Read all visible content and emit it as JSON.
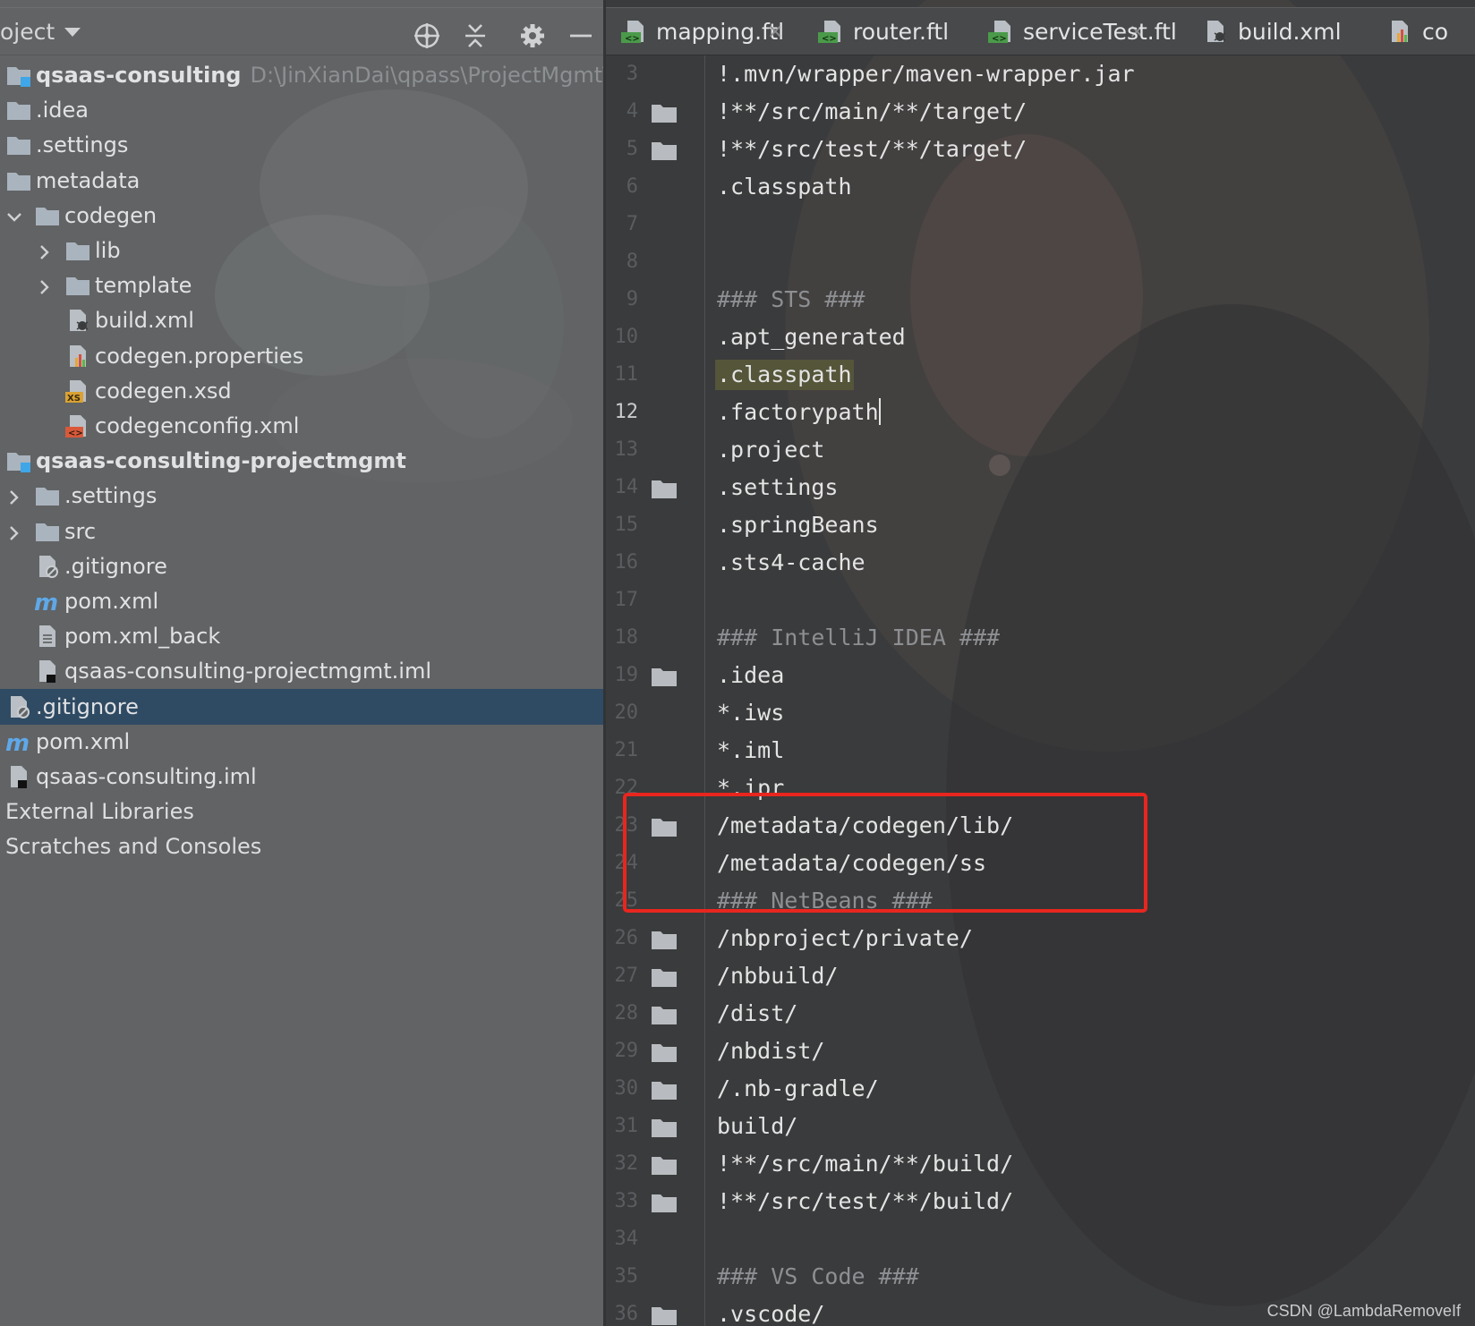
{
  "project_panel": {
    "title": "oject",
    "header_icons": [
      "locate-icon",
      "collapse-all-icon",
      "gear-icon",
      "minimize-icon"
    ],
    "tree": [
      {
        "label": "qsaas-consulting",
        "path": "D:\\JinXianDai\\qpass\\ProjectMgmt\\proje",
        "icon": "module-folder-icon",
        "bold": true,
        "chevron": "none"
      },
      {
        "label": ".idea",
        "icon": "folder-icon",
        "chevron": "none"
      },
      {
        "label": ".settings",
        "icon": "folder-icon",
        "chevron": "none"
      },
      {
        "label": "metadata",
        "icon": "folder-icon",
        "chevron": "none"
      },
      {
        "label": "codegen",
        "icon": "folder-icon",
        "chevron": "expanded"
      },
      {
        "label": "lib",
        "icon": "folder-icon",
        "chevron": "collapsed"
      },
      {
        "label": "template",
        "icon": "folder-icon",
        "chevron": "collapsed"
      },
      {
        "label": "build.xml",
        "icon": "ant-build-file-icon",
        "chevron": "none"
      },
      {
        "label": "codegen.properties",
        "icon": "properties-file-icon",
        "chevron": "none"
      },
      {
        "label": "codegen.xsd",
        "icon": "xsd-file-icon",
        "chevron": "none"
      },
      {
        "label": "codegenconfig.xml",
        "icon": "xml-file-icon",
        "chevron": "none"
      },
      {
        "label": "qsaas-consulting-projectmgmt",
        "icon": "module-folder-icon",
        "bold": true,
        "chevron": "none"
      },
      {
        "label": ".settings",
        "icon": "folder-icon",
        "chevron": "collapsed"
      },
      {
        "label": "src",
        "icon": "folder-icon",
        "chevron": "collapsed"
      },
      {
        "label": ".gitignore",
        "icon": "gitignore-file-icon",
        "chevron": "none"
      },
      {
        "label": "pom.xml",
        "icon": "maven-icon",
        "chevron": "none"
      },
      {
        "label": "pom.xml_back",
        "icon": "text-file-icon",
        "chevron": "none"
      },
      {
        "label": "qsaas-consulting-projectmgmt.iml",
        "icon": "iml-file-icon",
        "chevron": "none"
      },
      {
        "label": ".gitignore",
        "icon": "gitignore-file-icon",
        "chevron": "none",
        "selected": true
      },
      {
        "label": "pom.xml",
        "icon": "maven-icon",
        "chevron": "none"
      },
      {
        "label": "qsaas-consulting.iml",
        "icon": "iml-file-icon",
        "chevron": "none"
      },
      {
        "label": "External Libraries",
        "icon": "none",
        "chevron": "none"
      },
      {
        "label": "Scratches and Consoles",
        "icon": "none",
        "chevron": "none"
      }
    ]
  },
  "tabs": [
    {
      "label": "mapping.ftl",
      "icon": "ftl-file-icon",
      "close": "×"
    },
    {
      "label": "router.ftl",
      "icon": "ftl-file-icon",
      "close": "×"
    },
    {
      "label": "serviceTest.ftl",
      "icon": "ftl-file-icon",
      "close": "×"
    },
    {
      "label": "build.xml",
      "icon": "ant-build-file-icon",
      "close": "×"
    },
    {
      "label": "co",
      "icon": "properties-file-icon",
      "close": ""
    }
  ],
  "editor": {
    "current_line": 12,
    "lines": [
      {
        "n": "3",
        "text": "!.mvn/wrapper/maven-wrapper.jar",
        "fold": false
      },
      {
        "n": "4",
        "text": "!**/src/main/**/target/",
        "fold": true
      },
      {
        "n": "5",
        "text": "!**/src/test/**/target/",
        "fold": true
      },
      {
        "n": "6",
        "text": ".classpath",
        "fold": false
      },
      {
        "n": "7",
        "text": "",
        "fold": false
      },
      {
        "n": "8",
        "text": "",
        "fold": false
      },
      {
        "n": "9",
        "text": "### STS ###",
        "fold": false,
        "comment": true
      },
      {
        "n": "10",
        "text": ".apt_generated",
        "fold": false
      },
      {
        "n": "11",
        "text": ".classpath",
        "fold": false,
        "highlight": true
      },
      {
        "n": "12",
        "text": ".factorypath",
        "fold": false,
        "caret": true
      },
      {
        "n": "13",
        "text": ".project",
        "fold": false
      },
      {
        "n": "14",
        "text": ".settings",
        "fold": true
      },
      {
        "n": "15",
        "text": ".springBeans",
        "fold": false
      },
      {
        "n": "16",
        "text": ".sts4-cache",
        "fold": false
      },
      {
        "n": "17",
        "text": "",
        "fold": false
      },
      {
        "n": "18",
        "text": "### IntelliJ IDEA ###",
        "fold": false,
        "comment": true
      },
      {
        "n": "19",
        "text": ".idea",
        "fold": true
      },
      {
        "n": "20",
        "text": "*.iws",
        "fold": false
      },
      {
        "n": "21",
        "text": "*.iml",
        "fold": false
      },
      {
        "n": "22",
        "text": "*.ipr",
        "fold": false
      },
      {
        "n": "23",
        "text": "/metadata/codegen/lib/",
        "fold": true
      },
      {
        "n": "24",
        "text": "/metadata/codegen/ss",
        "fold": false
      },
      {
        "n": "25",
        "text": "### NetBeans ###",
        "fold": false,
        "comment": true
      },
      {
        "n": "26",
        "text": "/nbproject/private/",
        "fold": true
      },
      {
        "n": "27",
        "text": "/nbbuild/",
        "fold": true
      },
      {
        "n": "28",
        "text": "/dist/",
        "fold": true
      },
      {
        "n": "29",
        "text": "/nbdist/",
        "fold": true
      },
      {
        "n": "30",
        "text": "/.nb-gradle/",
        "fold": true
      },
      {
        "n": "31",
        "text": "build/",
        "fold": true
      },
      {
        "n": "32",
        "text": "!**/src/main/**/build/",
        "fold": true
      },
      {
        "n": "33",
        "text": "!**/src/test/**/build/",
        "fold": true
      },
      {
        "n": "34",
        "text": "",
        "fold": false
      },
      {
        "n": "35",
        "text": "### VS Code ###",
        "fold": false,
        "comment": true
      },
      {
        "n": "36",
        "text": ".vscode/",
        "fold": true
      }
    ]
  },
  "annotation": {
    "color": "#e8261f"
  },
  "watermark": "CSDN @LambdaRemoveIf",
  "colors": {
    "selection": "#2f4a63",
    "folder": "#aab4be",
    "maven": "#5fa8e8"
  }
}
